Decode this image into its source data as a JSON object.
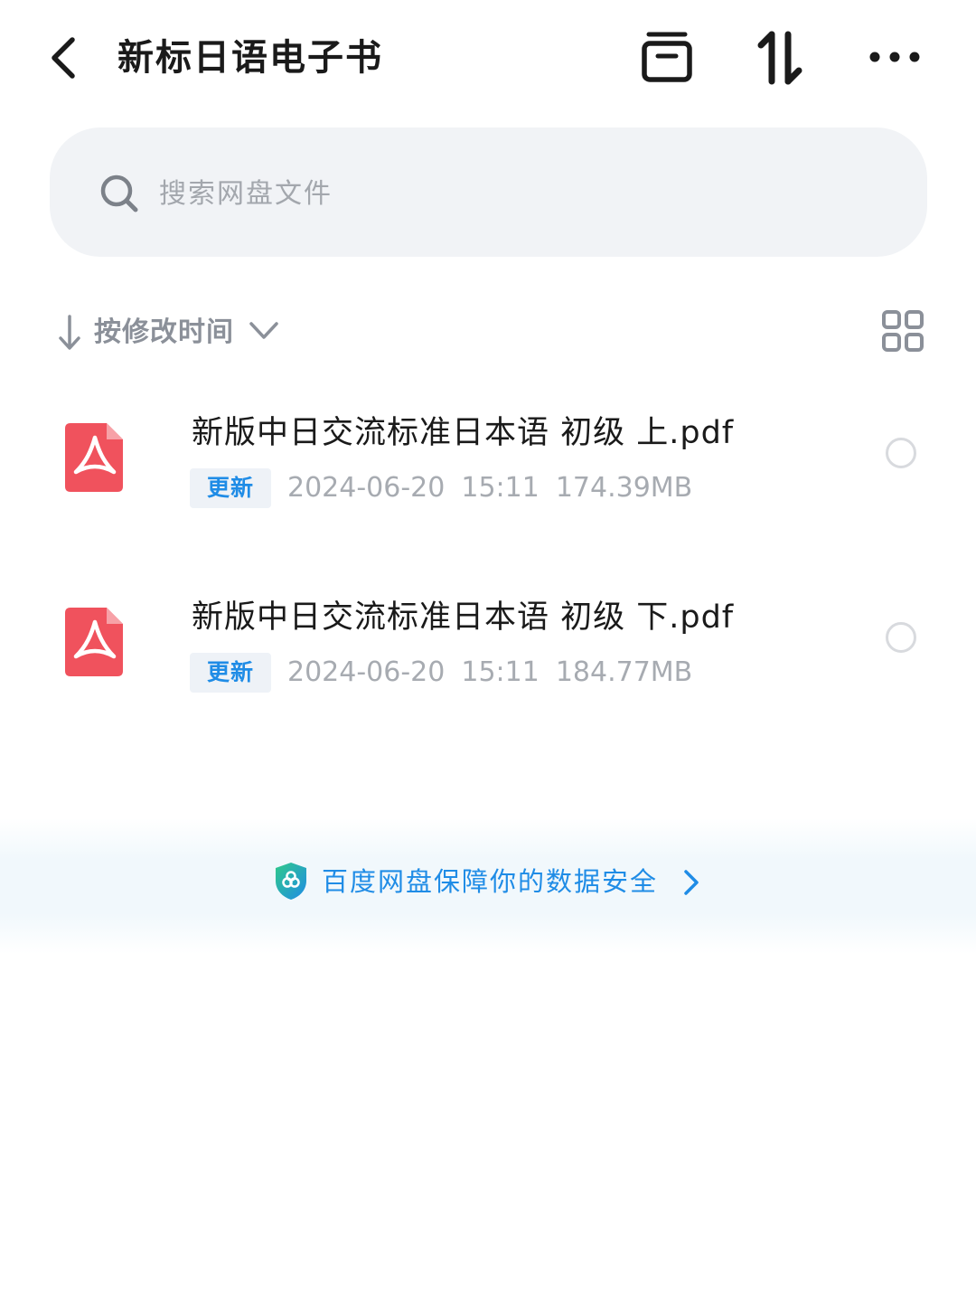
{
  "header": {
    "title": "新标日语电子书",
    "icons": [
      "back-icon",
      "archive-icon",
      "transfer-icon",
      "more-icon"
    ]
  },
  "search": {
    "placeholder": "搜索网盘文件",
    "value": ""
  },
  "sort": {
    "label": "按修改时间"
  },
  "files": [
    {
      "name": "新版中日交流标准日本语 初级 上.pdf",
      "badge": "更新",
      "date": "2024-06-20",
      "time": "15:11",
      "size": "174.39MB"
    },
    {
      "name": "新版中日交流标准日本语 初级 下.pdf",
      "badge": "更新",
      "date": "2024-06-20",
      "time": "15:11",
      "size": "184.77MB"
    }
  ],
  "promo": {
    "text": "百度网盘保障你的数据安全"
  },
  "colors": {
    "accent": "#1f8ce6",
    "pdf_red": "#f0525d",
    "search_bg": "#f1f3f6",
    "muted_text": "#a7abb1"
  }
}
